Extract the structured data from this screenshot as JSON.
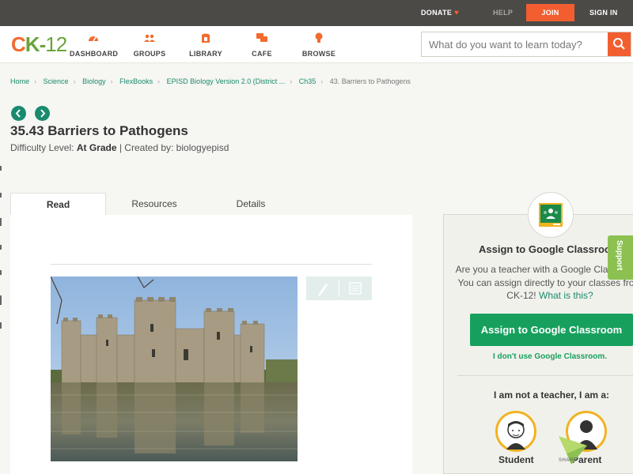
{
  "topbar": {
    "donate": "DONATE",
    "help": "HELP",
    "join": "JOIN",
    "signin": "SIGN IN"
  },
  "logo": {
    "c": "C",
    "k": "K",
    "dash": "-",
    "num": "12"
  },
  "nav": {
    "dashboard": "DASHBOARD",
    "groups": "GROUPS",
    "library": "LIBRARY",
    "cafe": "CAFE",
    "browse": "BROWSE"
  },
  "search": {
    "placeholder": "What do you want to learn today?"
  },
  "breadcrumb": {
    "home": "Home",
    "science": "Science",
    "biology": "Biology",
    "flexbooks": "FlexBooks",
    "book": "EPISD Biology Version 2.0 (District ...",
    "chapter": "Ch35",
    "current": "43. Barriers to Pathogens"
  },
  "page": {
    "title": "35.43 Barriers to Pathogens",
    "difficulty_label": "Difficulty Level:",
    "difficulty_value": "At Grade",
    "created_by": "| Created by: biologyepisd"
  },
  "tabs": {
    "read": "Read",
    "resources": "Resources",
    "details": "Details"
  },
  "panel": {
    "title": "Assign to Google Classroom",
    "text_1": "Are you a teacher with a Google Classroom? You can assign directly to your classes from CK-12!",
    "what_link": "What is this?",
    "assign_button": "Assign to Google Classroom",
    "no_gc": "I don't use Google Classroom.",
    "not_teacher": "I am not a teacher, I am a:",
    "student": "Student",
    "parent": "Parent"
  },
  "support": "Support",
  "share": "SHARE",
  "colors": {
    "accent_orange": "#f25e2f",
    "accent_green": "#1a8a6e",
    "classroom_green": "#17a05d",
    "topbar": "#4c4a47"
  }
}
